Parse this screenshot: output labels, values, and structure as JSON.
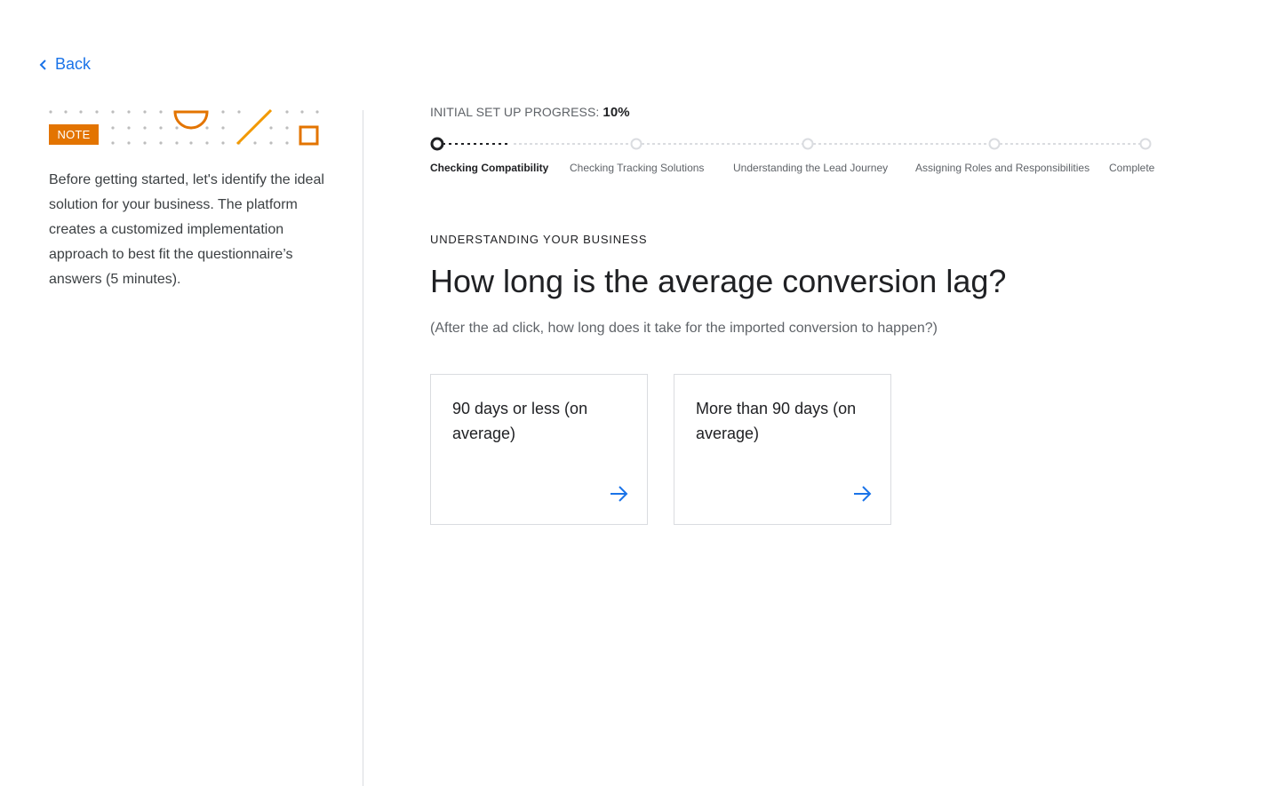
{
  "nav": {
    "back_label": "Back"
  },
  "note": {
    "badge": "NOTE",
    "text": "Before getting started, let's identify the ideal solution for your business. The platform creates a customized implementation approach to best fit the questionnaire’s answers (5 minutes).",
    "accent_color": "#e37400"
  },
  "progress": {
    "label": "INITIAL SET UP PROGRESS:",
    "percent_text": "10%",
    "value_fraction": 0.1,
    "steps": [
      {
        "label": "Checking Compatibility",
        "state": "current"
      },
      {
        "label": "Checking Tracking Solutions",
        "state": "upcoming"
      },
      {
        "label": "Understanding the Lead Journey",
        "state": "upcoming"
      },
      {
        "label": "Assigning Roles and Responsibilities",
        "state": "upcoming"
      },
      {
        "label": "Complete",
        "state": "upcoming"
      }
    ]
  },
  "section": {
    "eyebrow": "UNDERSTANDING YOUR BUSINESS",
    "question": "How long is the average conversion lag?",
    "subtext": "(After the ad click, how long does it take for the imported conversion to happen?)"
  },
  "options": [
    {
      "label": "90 days or less (on average)",
      "icon": "arrow-right-icon"
    },
    {
      "label": "More than 90 days (on average)",
      "icon": "arrow-right-icon"
    }
  ],
  "colors": {
    "link": "#1a73e8",
    "accent": "#e37400",
    "text_primary": "#202124",
    "text_secondary": "#5f6368",
    "border": "#dadce0"
  }
}
